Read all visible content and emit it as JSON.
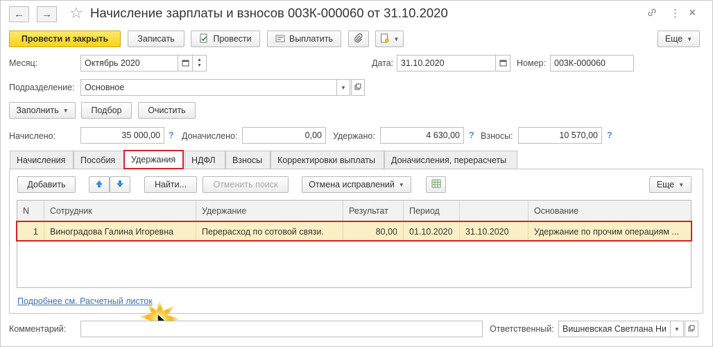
{
  "window": {
    "title": "Начисление зарплаты и взносов 003К-000060 от 31.10.2020",
    "nav_back": "←",
    "nav_forward": "→",
    "favorite": "☆",
    "link_icon": "🔗",
    "more_icon": "⋮",
    "close_icon": "×"
  },
  "toolbar": {
    "post_close": "Провести и закрыть",
    "save": "Записать",
    "post": "Провести",
    "pay": "Выплатить",
    "more": "Еще"
  },
  "form": {
    "month_label": "Месяц:",
    "month_value": "Октябрь 2020",
    "date_label": "Дата:",
    "date_value": "31.10.2020",
    "number_label": "Номер:",
    "number_value": "003К-000060",
    "division_label": "Подразделение:",
    "division_value": "Основное",
    "fill": "Заполнить",
    "selection": "Подбор",
    "clear": "Очистить",
    "accrued_label": "Начислено:",
    "accrued_value": "35 000,00",
    "additional_label": "Доначислено:",
    "additional_value": "0,00",
    "withheld_label": "Удержано:",
    "withheld_value": "4 630,00",
    "contrib_label": "Взносы:",
    "contrib_value": "10 570,00",
    "q": "?"
  },
  "tabs": [
    "Начисления",
    "Пособия",
    "Удержания",
    "НДФЛ",
    "Взносы",
    "Корректировки выплаты",
    "Доначисления, перерасчеты"
  ],
  "panel_toolbar": {
    "add": "Добавить",
    "find": "Найти...",
    "cancel_search": "Отменить поиск",
    "cancel_corrections": "Отмена исправлений",
    "more": "Еще"
  },
  "table": {
    "columns": [
      "N",
      "Сотрудник",
      "Удержание",
      "Результат",
      "Период",
      "",
      "Основание"
    ],
    "rows": [
      [
        "1",
        "Виноградова Галина Игоревна",
        "Перерасход по сотовой связи.",
        "80,00",
        "01.10.2020",
        "31.10.2020",
        "Удержание по прочим операциям ..."
      ]
    ]
  },
  "payslip_link": "Подробнее см. Расчетный листок",
  "footer": {
    "comment_label": "Комментарий:",
    "comment_value": "",
    "responsible_label": "Ответственный:",
    "responsible_value": "Вишневская Светлана Ни"
  },
  "colors": {
    "primary_button": "#f5d31c",
    "highlight": "#d3202a",
    "selected_row": "#fbf0c5",
    "link": "#3d6fb5"
  }
}
